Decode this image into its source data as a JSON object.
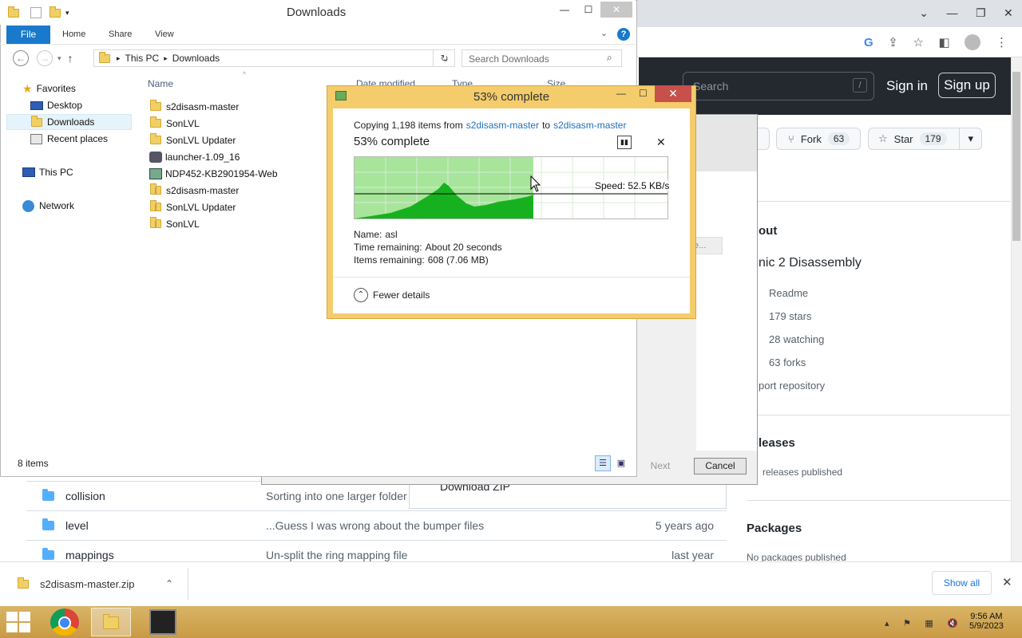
{
  "browser": {
    "github": {
      "search_placeholder": "Search",
      "search_key": "/",
      "sign_in": "Sign in",
      "sign_up": "Sign up",
      "fork_label": "Fork",
      "fork_count": "63",
      "star_label": "Star",
      "star_count": "179",
      "about_heading": "out",
      "repo_desc": "nic 2 Disassembly",
      "side_links": [
        "Readme",
        "179 stars",
        "28 watching",
        "63 forks"
      ],
      "report_link": "port repository",
      "releases_heading": "leases",
      "releases_text": "releases published",
      "packages_heading": "Packages",
      "packages_text": "No packages published"
    },
    "repo_rows": [
      {
        "name": "collision",
        "message": "Sorting into one larger folder",
        "age": ""
      },
      {
        "name": "level",
        "message": "...Guess I was wrong about the bumper files",
        "age": "5 years ago"
      },
      {
        "name": "mappings",
        "message": "Un-split the ring mapping file",
        "age": "last year"
      }
    ],
    "download_zip": "Download ZIP",
    "download_shelf": {
      "file": "s2disasm-master.zip",
      "show_all": "Show all"
    }
  },
  "wizard": {
    "next": "Next",
    "cancel": "Cancel",
    "field_fragment": "e..."
  },
  "explorer": {
    "title": "Downloads",
    "ribbon_tabs": {
      "file": "File",
      "home": "Home",
      "share": "Share",
      "view": "View"
    },
    "address": {
      "root": "This PC",
      "current": "Downloads"
    },
    "search_placeholder": "Search Downloads",
    "nav": {
      "favorites": "Favorites",
      "desktop": "Desktop",
      "downloads": "Downloads",
      "recent": "Recent places",
      "this_pc": "This PC",
      "network": "Network"
    },
    "columns": {
      "name": "Name",
      "date": "Date modified",
      "type": "Type",
      "size": "Size"
    },
    "files": [
      {
        "name": "s2disasm-master",
        "icon": "folder"
      },
      {
        "name": "SonLVL",
        "icon": "folder"
      },
      {
        "name": "SonLVL Updater",
        "icon": "folder"
      },
      {
        "name": "launcher-1.09_16",
        "icon": "app"
      },
      {
        "name": "NDP452-KB2901954-Web",
        "icon": "installer"
      },
      {
        "name": "s2disasm-master",
        "icon": "zip-folder"
      },
      {
        "name": "SonLVL Updater",
        "icon": "zip-folder"
      },
      {
        "name": "SonLVL",
        "icon": "zip-folder"
      }
    ],
    "status": "8 items"
  },
  "copy_dialog": {
    "title": "53% complete",
    "copying_prefix": "Copying 1,198 items from",
    "source": "s2disasm-master",
    "to": "to",
    "destination": "s2disasm-master",
    "heading": "53% complete",
    "progress_percent": 53,
    "speed": "Speed: 52.5 KB/s",
    "name_label": "Name:",
    "name_value": "asl",
    "time_label": "Time remaining:",
    "time_value": "About 20 seconds",
    "items_label": "Items remaining:",
    "items_value": "608 (7.06 MB)",
    "fewer_details": "Fewer details"
  },
  "tray": {
    "time": "9:56 AM",
    "date": "5/9/2023"
  }
}
